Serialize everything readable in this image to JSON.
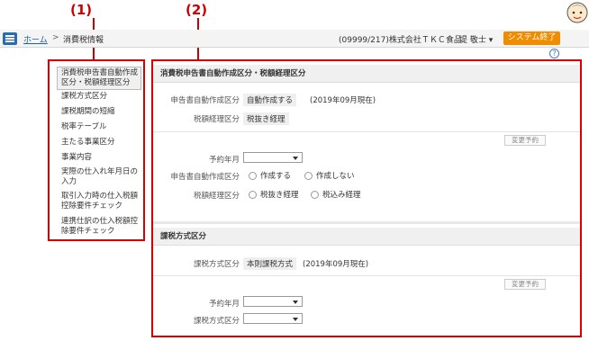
{
  "callouts": {
    "left": "(1)",
    "right": "(2)"
  },
  "topbar": {
    "breadcrumb_home": "ホーム",
    "breadcrumb_sep": ">",
    "breadcrumb_current": "消費税情報",
    "company": "(09999/217)株式会社ＴＫＣ食品",
    "user": "堤 敬士 ▾",
    "end_button": "システム終了"
  },
  "help": "?",
  "sidebar": {
    "items": [
      {
        "label_line1": "消費税申告書自動作成",
        "label_line2": "区分・税額経理区分"
      },
      {
        "label_line1": "課税方式区分"
      },
      {
        "label_line1": "課税期間の短縮"
      },
      {
        "label_line1": "税率テーブル"
      },
      {
        "label_line1": "主たる事業区分"
      },
      {
        "label_line1": "事業内容"
      },
      {
        "label_line1": "実際の仕入れ年月日の",
        "label_line2": "入力"
      },
      {
        "label_line1": "取引入力時の仕入税額",
        "label_line2": "控除要件チェック"
      },
      {
        "label_line1": "連携仕訳の仕入税額控",
        "label_line2": "除要件チェック"
      }
    ]
  },
  "section1": {
    "title": "消費税申告書自動作成区分・税額経理区分",
    "auto_label": "申告書自動作成区分",
    "auto_value": "自動作成する",
    "auto_date": "(2019年09月現在)",
    "tax_label": "税額経理区分",
    "tax_value": "税抜き経理",
    "reserve_button": "変更予約",
    "plan_label": "予約年月",
    "plan_auto_label": "申告書自動作成区分",
    "opt_create": "作成する",
    "opt_nocreate": "作成しない",
    "plan_tax_label": "税額経理区分",
    "opt_excl": "税抜き経理",
    "opt_incl": "税込み経理"
  },
  "section2": {
    "title": "課税方式区分",
    "method_label": "課税方式区分",
    "method_value": "本則課税方式",
    "method_date": "(2019年09月現在)",
    "reserve_button": "変更予約",
    "plan_label": "予約年月",
    "plan_method_label": "課税方式区分"
  },
  "colors": {
    "accent": "#2a6bb5",
    "callout": "#cc0000",
    "end_button": "#f08c00"
  }
}
